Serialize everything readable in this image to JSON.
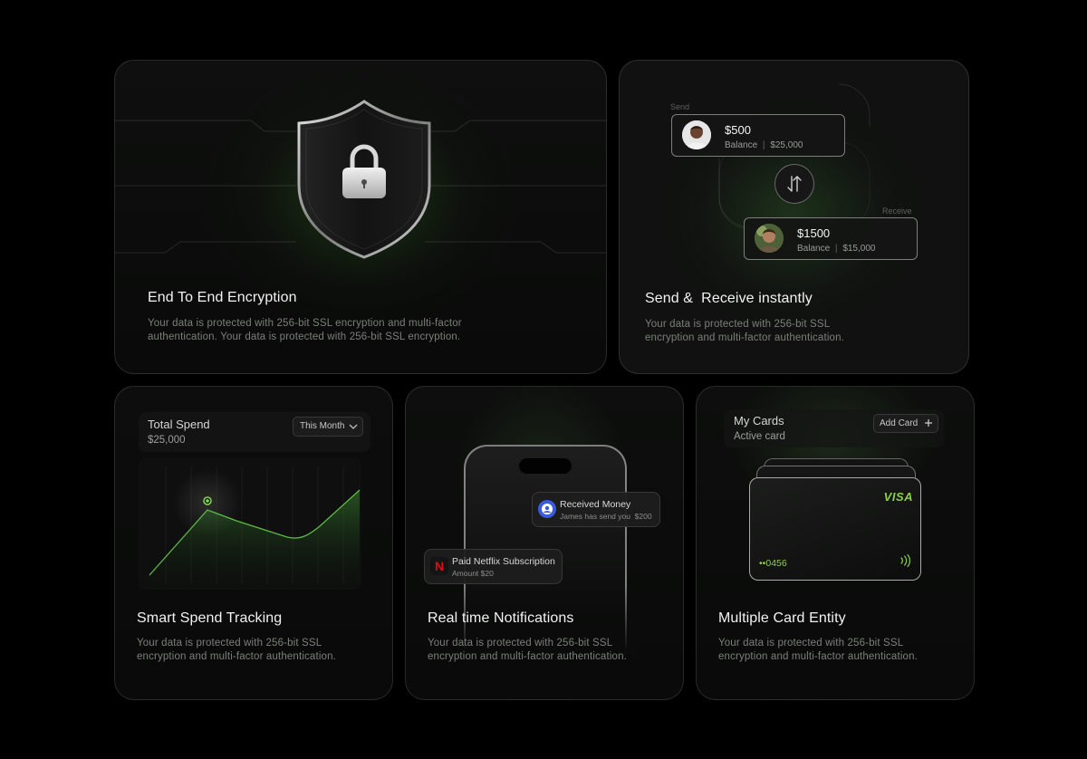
{
  "encryption": {
    "title": "End To End Encryption",
    "description": "Your data is protected with 256-bit SSL encryption and multi-factor authentication. Your data is protected with 256-bit SSL encryption.",
    "shield_icon": "shield-lock-icon"
  },
  "transfer": {
    "send_label": "Send",
    "receive_label": "Receive",
    "send": {
      "amount": "$500",
      "balance_label": "Balance",
      "balance_value": "$25,000"
    },
    "receive": {
      "amount": "$1500",
      "balance_label": "Balance",
      "balance_value": "$15,000"
    },
    "swap_icon": "swap-arrows-icon",
    "title": "Send &  Receive instantly",
    "description": "Your data is protected with 256-bit SSL encryption and multi-factor authentication."
  },
  "spend": {
    "label": "Total Spend",
    "value": "$25,000",
    "filter": "This Month",
    "title": "Smart Spend Tracking",
    "description": "Your data is protected with 256-bit SSL encryption and multi-factor authentication."
  },
  "notifications": {
    "items": [
      {
        "title": "Received Money",
        "subtitle": "James has send you  $200",
        "icon": "user-circle-icon"
      },
      {
        "title": "Paid Netflix Subscription",
        "subtitle": "Amount $20",
        "icon": "netflix-icon",
        "icon_text": "N"
      }
    ],
    "title": "Real time Notifications",
    "description": "Your data is protected with 256-bit SSL encryption and multi-factor authentication."
  },
  "cards": {
    "label": "My Cards",
    "sublabel": "Active card",
    "add_button": "Add Card",
    "add_icon": "plus-icon",
    "card_brand": "VISA",
    "card_number": "••0456",
    "contactless_icon": "contactless-icon",
    "title": "Multiple Card Entity",
    "description": "Your data is protected with 256-bit SSL encryption and multi-factor authentication."
  },
  "colors": {
    "background": "#000000",
    "accent_green": "#7fd14a",
    "text_primary": "#f2f2f2",
    "text_muted": "#7c7f7c"
  }
}
